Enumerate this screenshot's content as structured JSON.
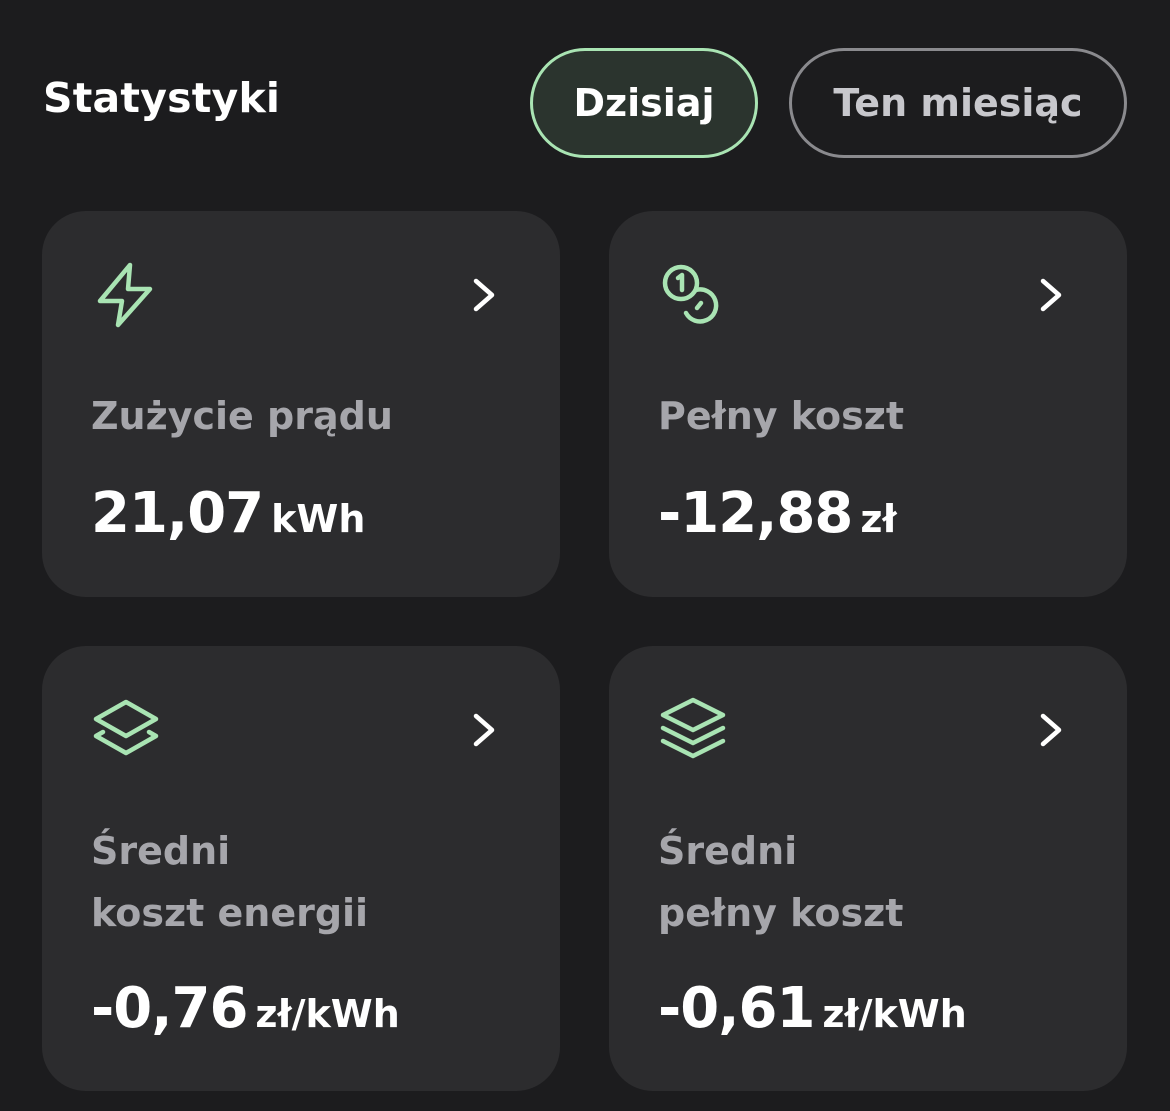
{
  "header": {
    "title": "Statystyki",
    "tabs": [
      {
        "label": "Dzisiaj",
        "active": true
      },
      {
        "label": "Ten miesiąc",
        "active": false
      }
    ]
  },
  "cards": [
    {
      "icon": "lightning-icon",
      "label_line1": "Zużycie prądu",
      "label_line2": "",
      "value": "21,07",
      "unit": "kWh"
    },
    {
      "icon": "coins-icon",
      "label_line1": "Pełny koszt",
      "label_line2": "",
      "value": "-12,88",
      "unit": "zł"
    },
    {
      "icon": "layers-icon",
      "label_line1": "Średni",
      "label_line2": "koszt energii",
      "value": "-0,76",
      "unit": "zł/kWh"
    },
    {
      "icon": "stack-icon",
      "label_line1": "Średni",
      "label_line2": "pełny koszt",
      "value": "-0,61",
      "unit": "zł/kWh"
    }
  ],
  "colors": {
    "background": "#1c1c1e",
    "card": "#2c2c2e",
    "accent": "#a9e4b3",
    "muted_text": "#a6a6ab"
  }
}
